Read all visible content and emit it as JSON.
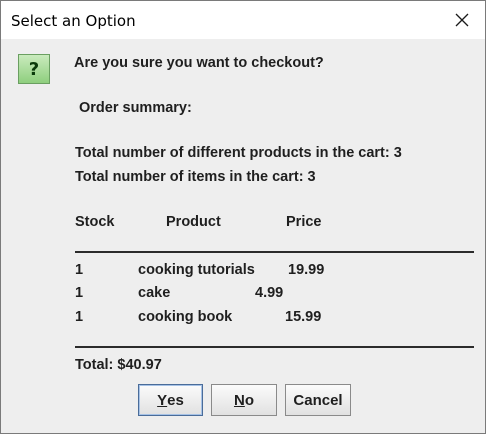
{
  "dialog": {
    "title": "Select an Option",
    "question": "Are you sure you want to checkout?",
    "summary_heading": "Order summary:",
    "distinct_products_line": "Total number of different products in the cart: 3",
    "items_line": "Total number of items in the cart: 3",
    "table": {
      "headers": {
        "stock": "Stock",
        "product": "Product",
        "price": "Price"
      },
      "rows": [
        {
          "stock": "1",
          "product": "cooking tutorials",
          "price": "19.99"
        },
        {
          "stock": "1",
          "product": "cake",
          "price": "4.99"
        },
        {
          "stock": "1",
          "product": "cooking book",
          "price": "15.99"
        }
      ]
    },
    "total": "Total: $40.97",
    "buttons": {
      "yes_mnemonic": "Y",
      "yes_rest": "es",
      "no_mnemonic": "N",
      "no_rest": "o",
      "cancel": "Cancel"
    },
    "icons": {
      "question": "question-mark-icon",
      "close": "close-icon"
    }
  }
}
